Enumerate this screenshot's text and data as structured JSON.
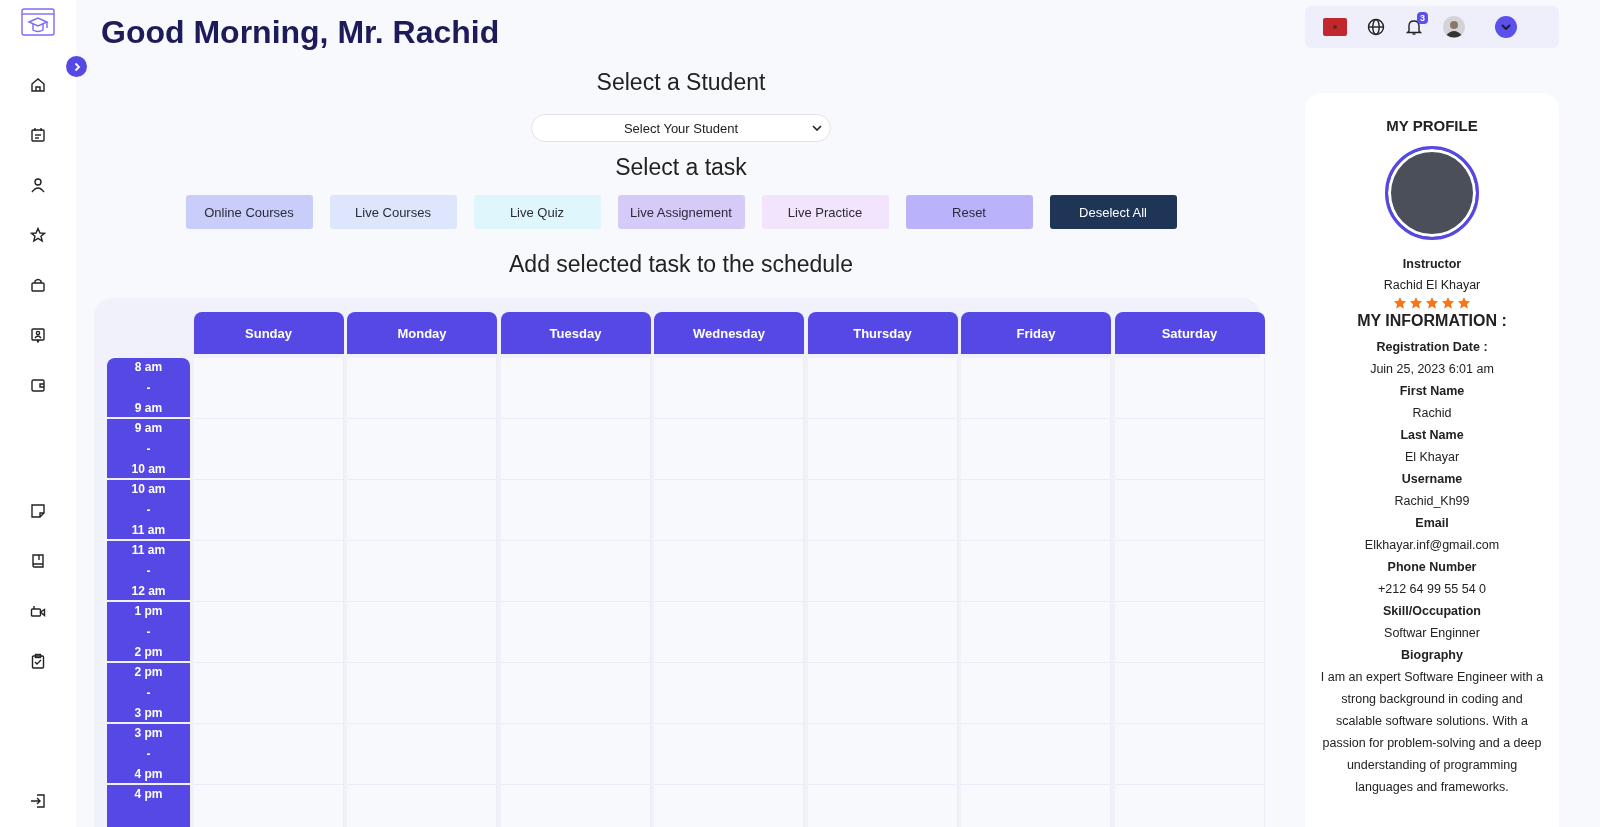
{
  "greeting": "Good Morning, Mr. Rachid",
  "topbar": {
    "notification_count": "3"
  },
  "student_section": {
    "title": "Select a Student",
    "select": {
      "value": "Select Your Student"
    }
  },
  "task_section": {
    "title": "Select a task",
    "buttons": [
      {
        "label": "Online Courses",
        "color": "#c9cdf9"
      },
      {
        "label": "Live Courses",
        "color": "#dde6fd"
      },
      {
        "label": "Live Quiz",
        "color": "#dff6fd"
      },
      {
        "label": "Live Assignement",
        "color": "#d6cbf8"
      },
      {
        "label": "Live Practice",
        "color": "#f1e4fc"
      },
      {
        "label": "Reset",
        "color": "#bab3fb"
      },
      {
        "label": "Deselect All",
        "color": "#1e3557"
      }
    ]
  },
  "schedule": {
    "title": "Add selected task to the schedule",
    "days": [
      "Sunday",
      "Monday",
      "Tuesday",
      "Wednesday",
      "Thursday",
      "Friday",
      "Saturday"
    ],
    "rows": [
      {
        "from": "8 am",
        "sep": "-",
        "to": "9 am"
      },
      {
        "from": "9 am",
        "sep": "-",
        "to": "10 am"
      },
      {
        "from": "10 am",
        "sep": "-",
        "to": "11 am"
      },
      {
        "from": "11 am",
        "sep": "-",
        "to": "12 am"
      },
      {
        "from": "1 pm",
        "sep": "-",
        "to": "2 pm"
      },
      {
        "from": "2 pm",
        "sep": "-",
        "to": "3 pm"
      },
      {
        "from": "3 pm",
        "sep": "-",
        "to": "4 pm"
      },
      {
        "from": "4 pm"
      }
    ]
  },
  "profile": {
    "title": "MY PROFILE",
    "role": "Instructor",
    "name": "Rachid El Khayar",
    "stars": 5,
    "info_title": "MY INFORMATION :",
    "fields": [
      {
        "label": "Registration Date :",
        "value": "Juin 25, 2023 6:01 am"
      },
      {
        "label": "First Name",
        "value": "Rachid"
      },
      {
        "label": "Last Name",
        "value": "El Khayar"
      },
      {
        "label": "Username",
        "value": "Rachid_Kh99"
      },
      {
        "label": "Email",
        "value": "Elkhayar.inf@gmail.com"
      },
      {
        "label": "Phone Number",
        "value": "+212 64 99 55 54 0"
      },
      {
        "label": "Skill/Occupation",
        "value": "Softwar Enginner"
      },
      {
        "label": "Biography",
        "value": "I am an expert Software Engineer with a strong background in coding and scalable software solutions. With a passion for problem-solving and a deep understanding of programming languages and frameworks."
      }
    ]
  }
}
